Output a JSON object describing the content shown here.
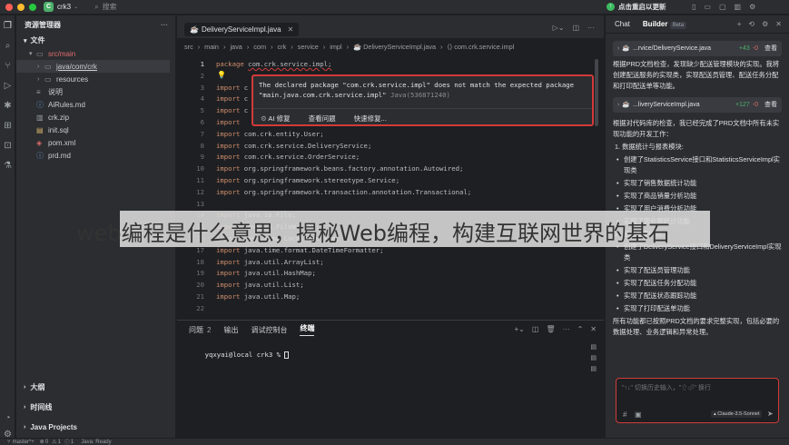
{
  "titlebar": {
    "project_badge": "C",
    "project_name": "crk3",
    "search_label": "搜索",
    "update_button": "点击重启以更新",
    "traffic": [
      "#ff5f57",
      "#febc2e",
      "#28c840"
    ]
  },
  "project": {
    "header": "资源管理器",
    "section": "文件",
    "tree": [
      {
        "label": "src/main",
        "indent": 0,
        "arrow": "▾",
        "icon": "folder-icon",
        "color": "#e06c6c"
      },
      {
        "label": "java/com/crk",
        "indent": 1,
        "arrow": "›",
        "icon": "folder-icon",
        "color": "#c9ccd1",
        "selected": true
      },
      {
        "label": "resources",
        "indent": 1,
        "arrow": "›",
        "icon": "folder-icon",
        "color": "#c9ccd1"
      },
      {
        "label": "说明",
        "indent": 0,
        "arrow": "",
        "icon": "file-icon",
        "color": "#c9ccd1"
      },
      {
        "label": "AiRules.md",
        "indent": 0,
        "arrow": "",
        "icon": "markdown-icon",
        "color": "#c9ccd1"
      },
      {
        "label": "crk.zip",
        "indent": 0,
        "arrow": "",
        "icon": "zip-icon",
        "color": "#c9ccd1"
      },
      {
        "label": "init.sql",
        "indent": 0,
        "arrow": "",
        "icon": "sql-icon",
        "color": "#c9ccd1"
      },
      {
        "label": "pom.xml",
        "indent": 0,
        "arrow": "",
        "icon": "xml-icon",
        "color": "#c9ccd1"
      },
      {
        "label": "prd.md",
        "indent": 0,
        "arrow": "",
        "icon": "markdown-icon",
        "color": "#c9ccd1"
      }
    ],
    "bottom_sections": [
      "大纲",
      "时间线",
      "Java Projects"
    ]
  },
  "editor": {
    "tab": "DeliveryServiceImpl.java",
    "breadcrumb": [
      "src",
      "main",
      "java",
      "com",
      "crk",
      "service",
      "impl",
      "DeliveryServiceImpl.java",
      "com.crk.service.impl"
    ],
    "lines": [
      {
        "n": "1",
        "kw": "package",
        "rest": "com.crk.service.impl;"
      },
      {
        "n": "2",
        "kw": "",
        "rest": ""
      },
      {
        "n": "3",
        "kw": "import",
        "rest": "c"
      },
      {
        "n": "4",
        "kw": "import",
        "rest": "c"
      },
      {
        "n": "5",
        "kw": "import",
        "rest": "c"
      },
      {
        "n": "6",
        "kw": "import",
        "rest": ""
      },
      {
        "n": "7",
        "kw": "import",
        "rest": "com.crk.entity.User;"
      },
      {
        "n": "8",
        "kw": "import",
        "rest": "com.crk.service.DeliveryService;"
      },
      {
        "n": "9",
        "kw": "import",
        "rest": "com.crk.service.OrderService;"
      },
      {
        "n": "10",
        "kw": "import",
        "rest": "org.springframework.beans.factory.annotation.Autowired;"
      },
      {
        "n": "11",
        "kw": "import",
        "rest": "org.springframework.stereotype.Service;"
      },
      {
        "n": "12",
        "kw": "import",
        "rest": "org.springframework.transaction.annotation.Transactional;"
      },
      {
        "n": "13",
        "kw": "",
        "rest": ""
      },
      {
        "n": "14",
        "kw": "import",
        "rest": "java.io.File;"
      },
      {
        "n": "15",
        "kw": "import",
        "rest": "java.io.FileWriter;"
      },
      {
        "n": "16",
        "kw": "import",
        "rest": "java.time.LocalDateTime;"
      },
      {
        "n": "17",
        "kw": "import",
        "rest": "java.time.format.DateTimeFormatter;"
      },
      {
        "n": "18",
        "kw": "import",
        "rest": "java.util.ArrayList;"
      },
      {
        "n": "19",
        "kw": "import",
        "rest": "java.util.HashMap;"
      },
      {
        "n": "20",
        "kw": "import",
        "rest": "java.util.List;"
      },
      {
        "n": "21",
        "kw": "import",
        "rest": "java.util.Map;"
      },
      {
        "n": "22",
        "kw": "",
        "rest": ""
      }
    ],
    "popup": {
      "message": "The declared package \"com.crk.service.impl\" does not match the expected package\n\"main.java.com.crk.service.impl\"",
      "code": "Java(536871240)",
      "actions": [
        "AI 修复",
        "查看问题",
        "快速修复..."
      ]
    }
  },
  "terminal": {
    "tabs": [
      {
        "label": "问题",
        "badge": "2"
      },
      {
        "label": "输出",
        "badge": ""
      },
      {
        "label": "调试控制台",
        "badge": ""
      },
      {
        "label": "终端",
        "badge": "",
        "active": true
      }
    ],
    "prompt": "yqxyai@local crk3 % "
  },
  "watermark": "web编程是什么意思，揭秘Web编程，构建互联网世界的基石",
  "right": {
    "tabs": [
      "Chat",
      "Builder"
    ],
    "beta": "Beta",
    "file1": {
      "name": "...rvice/DeliveryService.java",
      "add": "+43",
      "del": "-0",
      "action": "查看"
    },
    "text1": "根据PRD文档检查，发现缺少配送管理模块的实现。我将创建配送服务的实现类，实现配送员管理、配送任务分配和打印配送单等功能。",
    "file2": {
      "name": "...liveryServiceImpl.java",
      "add": "+127",
      "del": "-0",
      "action": "查看"
    },
    "text2": "根据对代码库的检查，我已经完成了PRD文档中所有未实现功能的开发工作：",
    "list": [
      {
        "type": "num",
        "text": "1. 数据统计与报表模块:"
      },
      {
        "type": "bullet",
        "text": "创建了StatisticsService接口和StatisticsServiceImpl实现类"
      },
      {
        "type": "bullet",
        "text": "实现了销售数据统计功能"
      },
      {
        "type": "bullet",
        "text": "实现了商品销量分析功能"
      },
      {
        "type": "bullet",
        "text": "实现了用户消费分析功能"
      },
      {
        "type": "bullet",
        "text": "实现了营业额统计功能"
      },
      {
        "type": "num",
        "text": "2. 配送管理模块:"
      },
      {
        "type": "bullet",
        "text": "创建了DeliveryService接口和DeliveryServiceImpl实现类"
      },
      {
        "type": "bullet",
        "text": "实现了配送员管理功能"
      },
      {
        "type": "bullet",
        "text": "实现了配送任务分配功能"
      },
      {
        "type": "bullet",
        "text": "实现了配送状态跟踪功能"
      },
      {
        "type": "bullet",
        "text": "实现了打印配送单功能"
      }
    ],
    "text3": "所有功能都已按照PRD文档的要求完整实现，包括必要的数据处理、业务逻辑和异常处理。",
    "input_placeholder": "\"↑↓\" 切换历史输入，\"⇧⏎\" 换行",
    "model": "Claude-3.5-Sonnet"
  },
  "status": {
    "branch": "master*+",
    "errors": "0",
    "warnings": "1",
    "info": "1",
    "java": "Java: Ready"
  }
}
